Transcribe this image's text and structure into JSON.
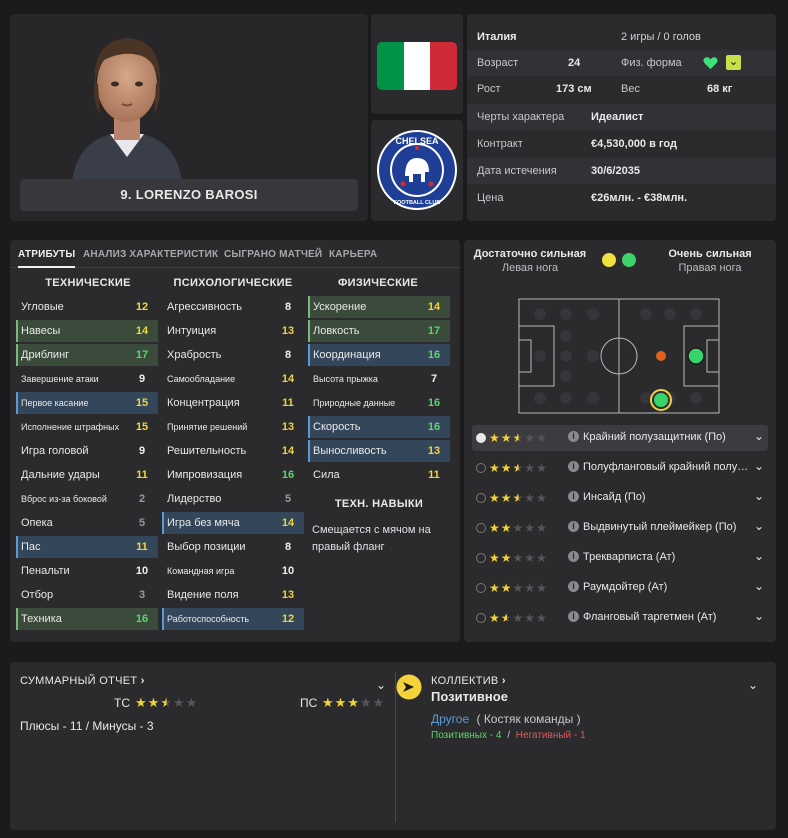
{
  "player": {
    "name": "9. LORENZO BAROSI"
  },
  "flag_colors": [
    "#009246",
    "#ffffff",
    "#ce2b37"
  ],
  "club": {
    "ring_text": "CHELSEA",
    "bottom_text": "FOOTBALL CLUB"
  },
  "info": {
    "nation": "Италия",
    "caps": "2 игры / 0 голов",
    "age_label": "Возраст",
    "age": "24",
    "fitness_label": "Физ. форма",
    "height_label": "Рост",
    "height": "173 см",
    "weight_label": "Вес",
    "weight": "68 кг",
    "personality_label": "Черты характера",
    "personality": "Идеалист",
    "contract_label": "Контракт",
    "contract": "€4,530,000 в год",
    "expiry_label": "Дата истечения",
    "expiry": "30/6/2035",
    "value_label": "Цена",
    "value": "€26млн. - €38млн."
  },
  "tabs": [
    "АТРИБУТЫ",
    "АНАЛИЗ ХАРАКТЕРИСТИК",
    "СЫГРАНО МАТЧЕЙ",
    "КАРЬЕРА"
  ],
  "columns": {
    "technical": "ТЕХНИЧЕСКИЕ",
    "mental": "ПСИХОЛОГИЧЕСКИЕ",
    "physical": "ФИЗИЧЕСКИЕ",
    "tech_skills": "ТЕХН. НАВЫКИ"
  },
  "technical": [
    {
      "label": "Угловые",
      "value": "12"
    },
    {
      "label": "Навесы",
      "value": "14"
    },
    {
      "label": "Дриблинг",
      "value": "17"
    },
    {
      "label": "Завершение атаки",
      "value": "9"
    },
    {
      "label": "Первое касание",
      "value": "15"
    },
    {
      "label": "Исполнение штрафных",
      "value": "15"
    },
    {
      "label": "Игра головой",
      "value": "9"
    },
    {
      "label": "Дальние удары",
      "value": "11"
    },
    {
      "label": "Вброс из-за боковой",
      "value": "2"
    },
    {
      "label": "Опека",
      "value": "5"
    },
    {
      "label": "Пас",
      "value": "11"
    },
    {
      "label": "Пенальти",
      "value": "10"
    },
    {
      "label": "Отбор",
      "value": "3"
    },
    {
      "label": "Техника",
      "value": "16"
    }
  ],
  "mental": [
    {
      "label": "Агрессивность",
      "value": "8"
    },
    {
      "label": "Интуиция",
      "value": "13"
    },
    {
      "label": "Храбрость",
      "value": "8"
    },
    {
      "label": "Самообладание",
      "value": "14"
    },
    {
      "label": "Концентрация",
      "value": "11"
    },
    {
      "label": "Принятие решений",
      "value": "13"
    },
    {
      "label": "Решительность",
      "value": "14"
    },
    {
      "label": "Импровизация",
      "value": "16"
    },
    {
      "label": "Лидерство",
      "value": "5"
    },
    {
      "label": "Игра без мяча",
      "value": "14"
    },
    {
      "label": "Выбор позиции",
      "value": "8"
    },
    {
      "label": "Командная игра",
      "value": "10"
    },
    {
      "label": "Видение поля",
      "value": "13"
    },
    {
      "label": "Работоспособность",
      "value": "12"
    }
  ],
  "physical": [
    {
      "label": "Ускорение",
      "value": "14"
    },
    {
      "label": "Ловкость",
      "value": "17"
    },
    {
      "label": "Координация",
      "value": "16"
    },
    {
      "label": "Высота прыжка",
      "value": "7"
    },
    {
      "label": "Природные данные",
      "value": "16"
    },
    {
      "label": "Скорость",
      "value": "16"
    },
    {
      "label": "Выносливость",
      "value": "13"
    },
    {
      "label": "Сила",
      "value": "11"
    }
  ],
  "tech_skill_text": "Смещается с мячом на правый фланг",
  "feet": {
    "left_rating": "Достаточно сильная",
    "left_label": "Левая нога",
    "right_rating": "Очень сильная",
    "right_label": "Правая нога",
    "left_color": "#f0e040",
    "right_color": "#3ed36a"
  },
  "roles": [
    {
      "name": "Крайний полузащитник (По)",
      "stars": 2.5,
      "selected": true
    },
    {
      "name": "Полуфланговый крайний полузащитник (Ат)",
      "stars": 2.5,
      "selected": false
    },
    {
      "name": "Инсайд (По)",
      "stars": 2.5,
      "selected": false
    },
    {
      "name": "Выдвинутый плеймейкер (По)",
      "stars": 2,
      "selected": false
    },
    {
      "name": "Трекварписта (Ат)",
      "stars": 2,
      "selected": false
    },
    {
      "name": "Раумдойтер (Ат)",
      "stars": 2,
      "selected": false
    },
    {
      "name": "Фланговый таргетмен (Ат)",
      "stars": 1.5,
      "selected": false
    }
  ],
  "summary": {
    "title": "СУММАРНЫЙ ОТЧЕТ",
    "tc_label": "ТС",
    "tc_stars": 2.5,
    "pc_label": "ПС",
    "pc_stars": 3,
    "pros_cons": "Плюсы - 11 / Минусы - 3"
  },
  "team": {
    "title": "КОЛЛЕКТИВ",
    "status": "Позитивное",
    "friend_link": "Другое",
    "role": "( Костяк команды )",
    "positive": "Позитивных - 4",
    "negative": "Негативный - 1",
    "sep": "/"
  }
}
